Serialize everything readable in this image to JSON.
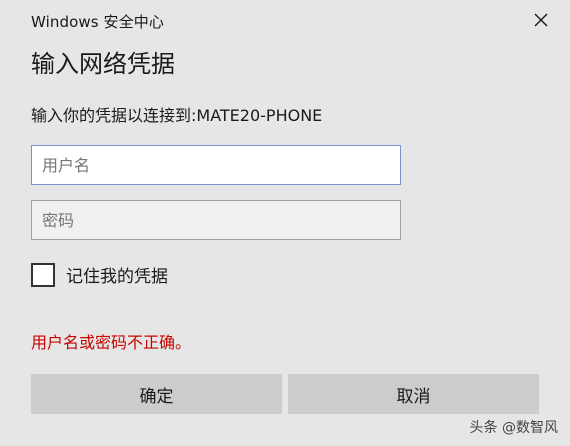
{
  "window": {
    "title": "Windows 安全中心",
    "close_icon": "close-icon"
  },
  "heading": "输入网络凭据",
  "subheading": "输入你的凭据以连接到:MATE20-PHONE",
  "fields": {
    "username_placeholder": "用户名",
    "username_value": "",
    "password_placeholder": "密码",
    "password_value": ""
  },
  "remember": {
    "label": "记住我的凭据",
    "checked": false
  },
  "error_message": "用户名或密码不正确。",
  "buttons": {
    "ok_label": "确定",
    "cancel_label": "取消"
  },
  "watermark": "头条 @数智风",
  "colors": {
    "background": "#e6e6e6",
    "error": "#c50500",
    "focus_border": "#7a93c9",
    "button": "#cccccc"
  }
}
